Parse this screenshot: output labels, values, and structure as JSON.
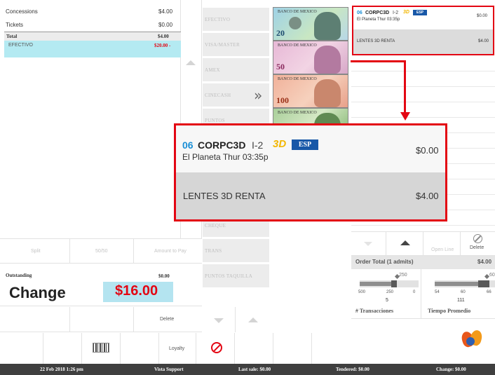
{
  "receipt": {
    "lines": [
      {
        "label": "Concessions",
        "value": "$4.00"
      },
      {
        "label": "Tickets",
        "value": "$0.00"
      }
    ],
    "total_label": "Total",
    "total_value": "$4.00",
    "payment_label": "EFECTIVO",
    "payment_value": "$20.00 -"
  },
  "payment_methods": [
    "EFECTIVO",
    "VISA/MASTER",
    "AMEX",
    "CINECASH",
    "PUNTOS",
    "CHEQUE",
    "TRANS",
    "PUNTOS TAQUILLA"
  ],
  "bills": [
    "20",
    "50",
    "100",
    "200"
  ],
  "bill_header": "BANCO DE MEXICO",
  "order_small": {
    "title_num": "06",
    "title": "CORPC3D",
    "auditorium": "I-2",
    "badge_3d": "3D",
    "badge_lang": "ESP",
    "sub": "El Planeta Thur 03:35p",
    "price": "$0.00",
    "item": "LENTES 3D RENTA",
    "item_price": "$4.00"
  },
  "order_zoom": {
    "title_num": "06",
    "title": "CORPC3D",
    "auditorium": "I-2",
    "badge_3d": "3D",
    "badge_lang": "ESP",
    "sub": "El Planeta Thur 03:35p",
    "price": "$0.00",
    "item": "LENTES 3D RENTA",
    "item_price": "$4.00"
  },
  "actions": {
    "split": "Split",
    "fifty": "50/50",
    "amount_to_pay": "Amount to Pay",
    "delete": "Delete",
    "loyalty": "Loyalty",
    "open_line": "Open Line",
    "delete_right": "Delete"
  },
  "outstanding": {
    "label": "Outstanding",
    "value": "$0.00",
    "change_label": "Change",
    "change_value": "$16.00"
  },
  "order_total": {
    "label": "Order Total (1 admits)",
    "value": "$4.00"
  },
  "gauges": [
    {
      "marker": "250",
      "ticks": [
        "500",
        "250",
        "0"
      ],
      "value": "5",
      "label": "# Transacciones",
      "level": 0.6
    },
    {
      "marker": "60",
      "ticks": [
        "54",
        "60",
        "66"
      ],
      "value": "111",
      "label": "Tiempo Promedio",
      "level": 0.75
    }
  ],
  "footer": {
    "datetime": "22 Feb 2018 1:26 pm",
    "support": "Vista Support",
    "last_sale": "Last sale: $0.00",
    "tendered": "Tendered: $0.00",
    "change": "Change: $0.00"
  },
  "colors": {
    "accent_red": "#e30613",
    "change_bg": "#b4e4f0",
    "payment_highlight": "#b4eaf2",
    "footer": "#3f3f3f"
  }
}
